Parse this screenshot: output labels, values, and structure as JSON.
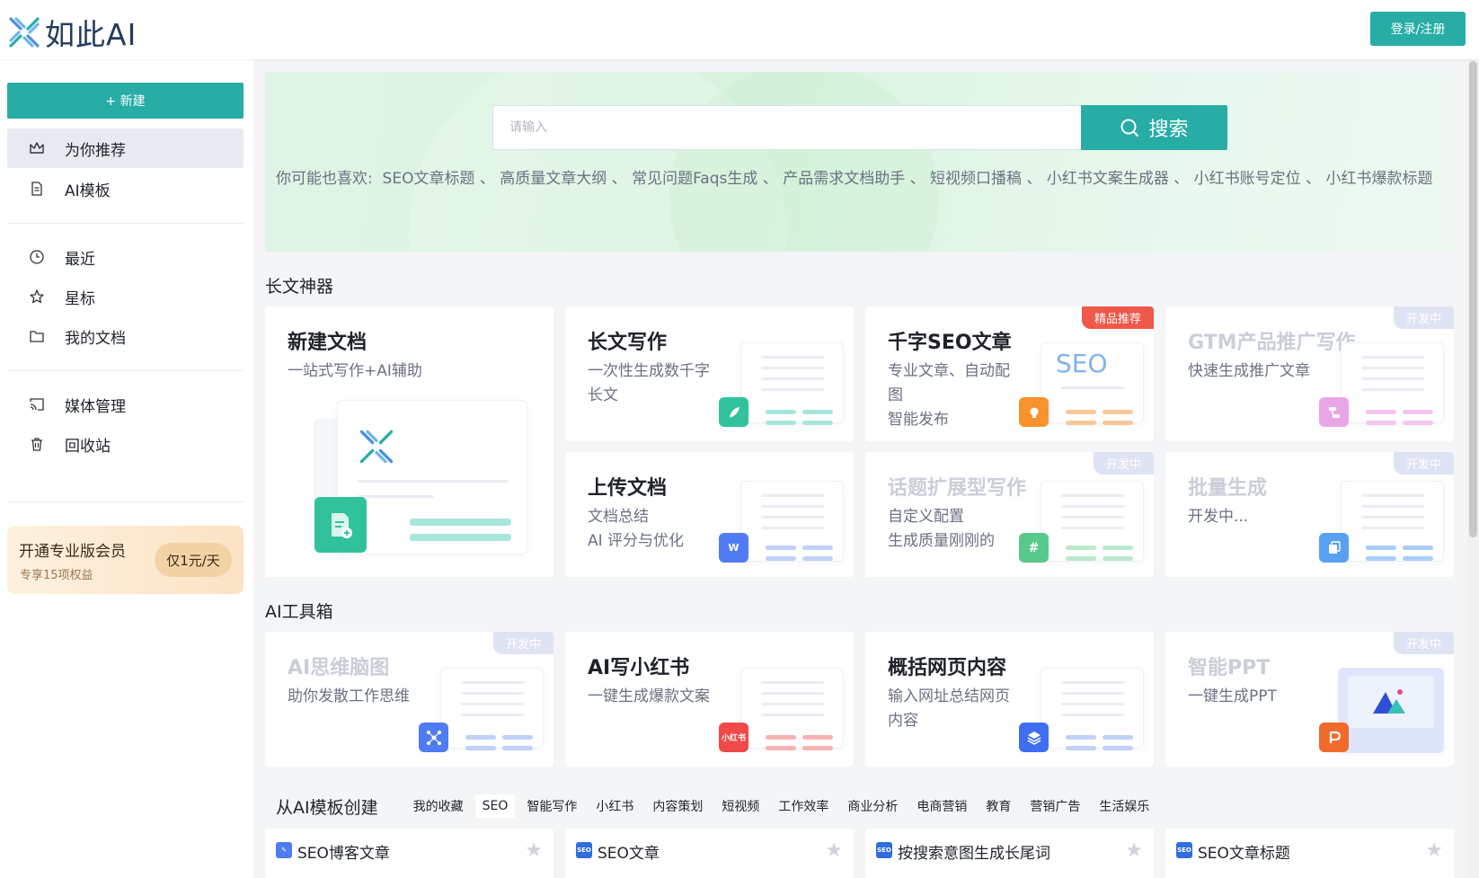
{
  "brand": {
    "name": "如此AI",
    "accent": "#27ada6"
  },
  "header": {
    "login_label": "登录/注册"
  },
  "sidebar": {
    "new_label": "+ 新建",
    "items": [
      {
        "label": "为你推荐",
        "icon": "crown-icon"
      },
      {
        "label": "AI模板",
        "icon": "document-icon"
      },
      {
        "label": "最近",
        "icon": "clock-icon"
      },
      {
        "label": "星标",
        "icon": "star-icon"
      },
      {
        "label": "我的文档",
        "icon": "folder-icon"
      },
      {
        "label": "媒体管理",
        "icon": "cast-icon"
      },
      {
        "label": "回收站",
        "icon": "trash-icon"
      }
    ],
    "vip": {
      "title": "开通专业版会员",
      "subtitle": "专享15项权益",
      "price": "仅1元/天"
    }
  },
  "search": {
    "placeholder": "请输入",
    "button_label": "搜索",
    "suggest_label": "你可能也喜欢:",
    "suggestions": [
      "SEO文章标题",
      "高质量文章大纲",
      "常见问题Faqs生成",
      "产品需求文档助手",
      "短视频口播稿",
      "小红书文案生成器",
      "小红书账号定位",
      "小红书爆款标题"
    ]
  },
  "sections": {
    "longform": "长文神器",
    "toolbox": "AI工具箱"
  },
  "longform_cards": [
    {
      "title": "新建文档",
      "desc": "一站式写作+AI辅助"
    },
    {
      "title": "长文写作",
      "desc": "一次性生成数千字长文"
    },
    {
      "title": "千字SEO文章",
      "desc": "专业文章、自动配图\n智能发布",
      "tag": "精品推荐",
      "art": "SEO"
    },
    {
      "title": "GTM产品推广写作",
      "desc": "快速生成推广文章",
      "tag": "开发中"
    },
    {
      "title": "上传文档",
      "desc": "文档总结\nAI 评分与优化",
      "badge": "W"
    },
    {
      "title": "话题扩展型写作",
      "desc": "自定义配置\n生成质量刚刚的",
      "tag": "开发中",
      "badge": "#"
    },
    {
      "title": "批量生成",
      "desc": "开发中...",
      "tag": "开发中"
    }
  ],
  "toolbox_cards": [
    {
      "title": "AI思维脑图",
      "desc": "助你发散工作思维",
      "tag": "开发中"
    },
    {
      "title": "AI写小红书",
      "desc": "一键生成爆款文案",
      "badge": "小红书"
    },
    {
      "title": "概括网页内容",
      "desc": "输入网址总结网页内容"
    },
    {
      "title": "智能PPT",
      "desc": "一键生成PPT",
      "tag": "开发中"
    }
  ],
  "templates": {
    "title": "从AI模板创建",
    "tabs": [
      "我的收藏",
      "SEO",
      "智能写作",
      "小红书",
      "内容策划",
      "短视频",
      "工作效率",
      "商业分析",
      "电商营销",
      "教育",
      "营销广告",
      "生活娱乐"
    ],
    "active_tab": "SEO",
    "items": [
      {
        "title": "SEO博客文章",
        "icon": "pen-icon"
      },
      {
        "title": "SEO文章",
        "icon": "seo-icon"
      },
      {
        "title": "按搜索意图生成长尾词",
        "icon": "seo-icon"
      },
      {
        "title": "SEO文章标题",
        "icon": "seo-icon"
      }
    ]
  }
}
